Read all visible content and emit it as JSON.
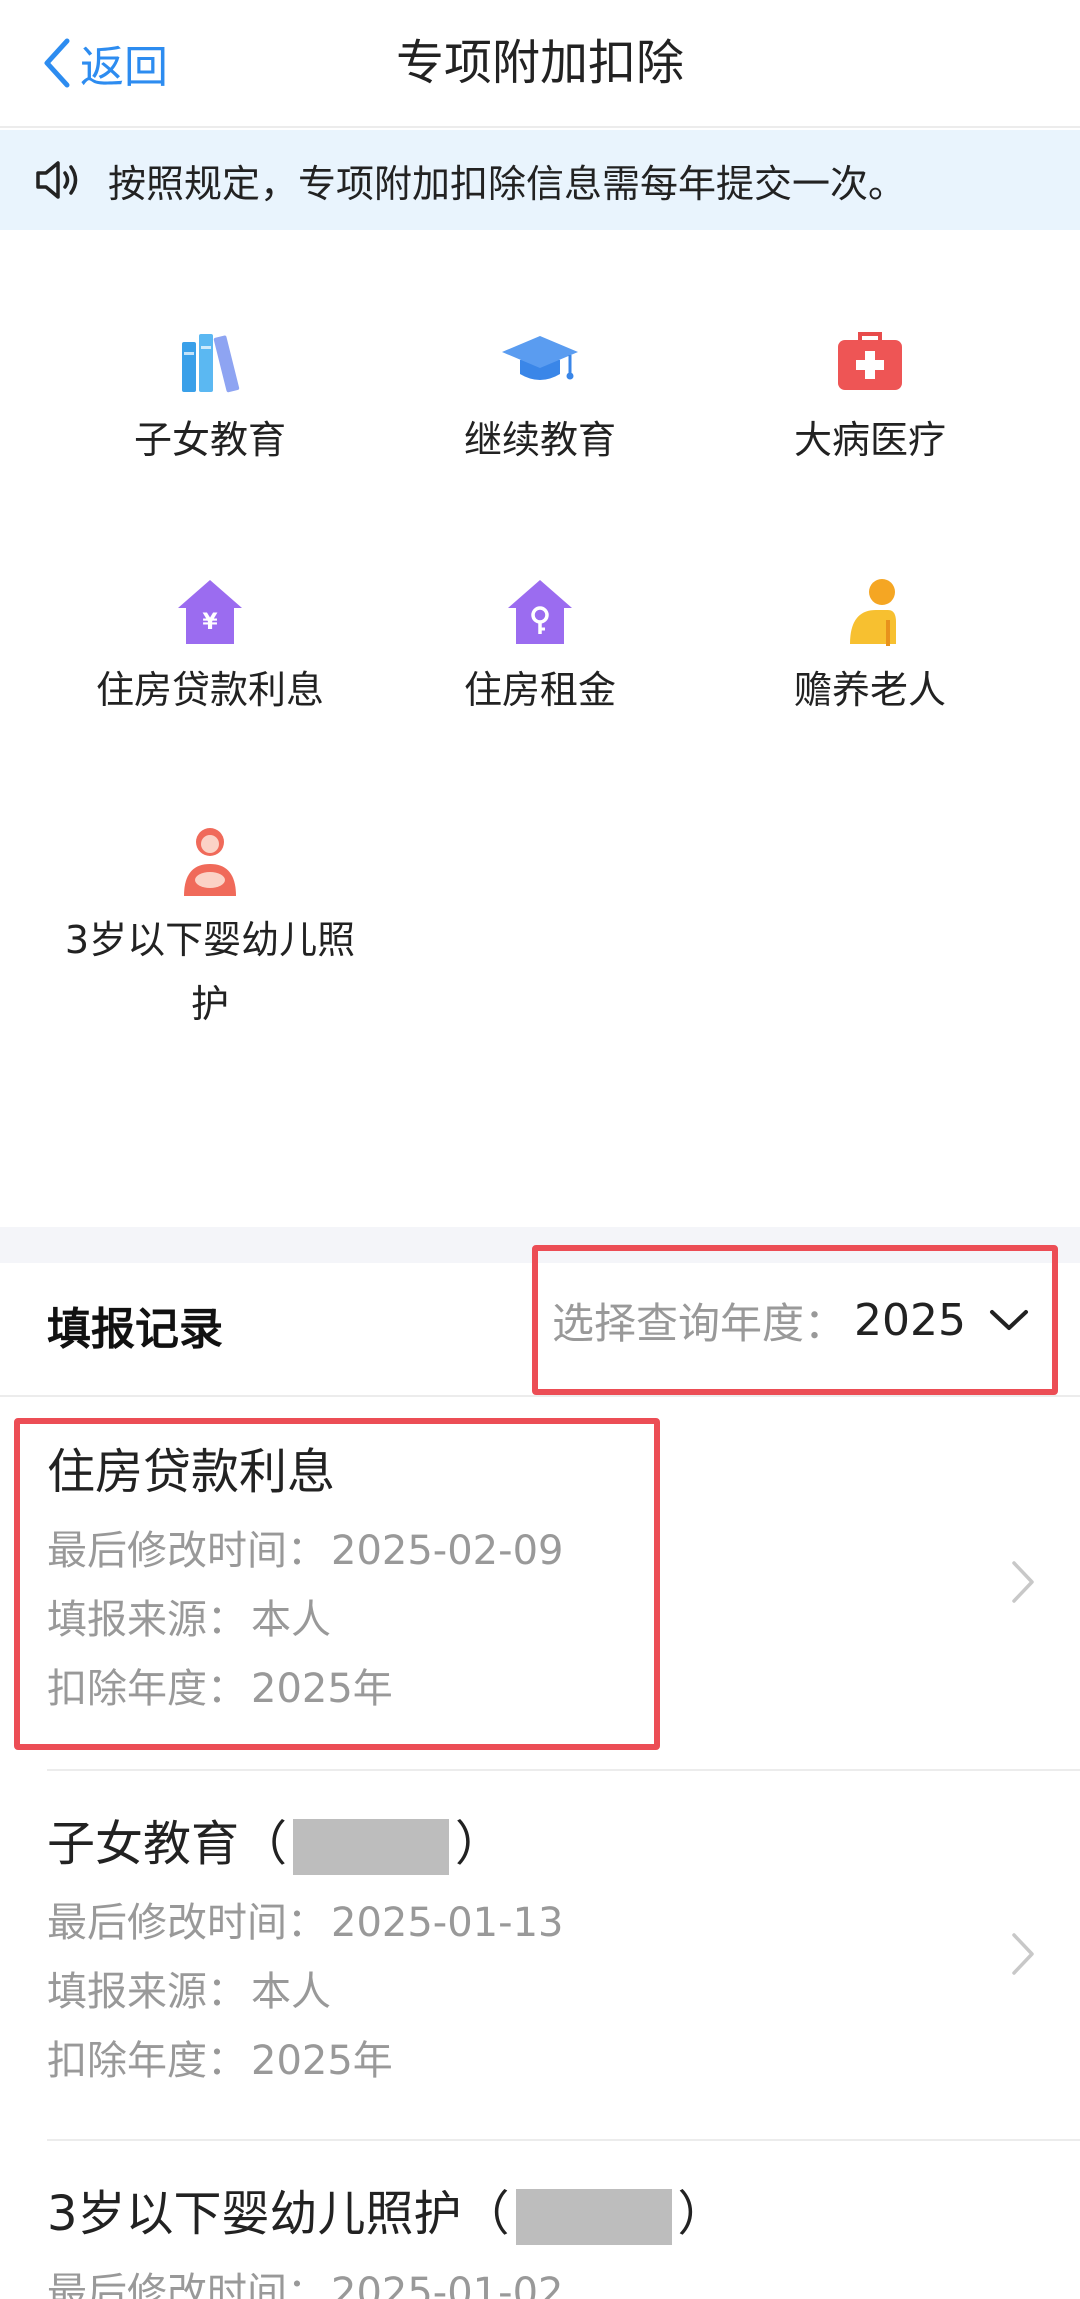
{
  "nav": {
    "back_label": "返回",
    "title": "专项附加扣除"
  },
  "notice": {
    "text": "按照规定，专项附加扣除信息需每年提交一次。"
  },
  "categories": [
    {
      "label": "子女教育",
      "icon": "books-icon"
    },
    {
      "label": "继续教育",
      "icon": "graduation-cap-icon"
    },
    {
      "label": "大病医疗",
      "icon": "medical-kit-icon"
    },
    {
      "label": "住房贷款利息",
      "icon": "house-yuan-icon"
    },
    {
      "label": "住房租金",
      "icon": "house-key-icon"
    },
    {
      "label": "赡养老人",
      "icon": "elderly-icon"
    },
    {
      "label": "3岁以下婴幼儿照护",
      "label_line1": "3岁以下婴幼儿照",
      "label_line2": "护",
      "icon": "mother-baby-icon"
    }
  ],
  "records_header": {
    "title": "填报记录",
    "year_label": "选择查询年度：",
    "year_value": "2025"
  },
  "meta_labels": {
    "modified": "最后修改时间：",
    "source": "填报来源：",
    "year": "扣除年度："
  },
  "records": [
    {
      "title": "住房贷款利息",
      "modified": "2025-02-09",
      "source": "本人",
      "year": "2025年"
    },
    {
      "title_prefix": "子女教育（",
      "title_suffix": "）",
      "modified": "2025-01-13",
      "source": "本人",
      "year": "2025年"
    },
    {
      "title_prefix": "3岁以下婴幼儿照护（",
      "title_suffix": "）",
      "modified": "2025-01-02"
    }
  ],
  "colors": {
    "accent": "#2d8cf0",
    "highlight": "#ec4d55",
    "notice_bg": "#e9f4fd",
    "meta_text": "#999999"
  }
}
